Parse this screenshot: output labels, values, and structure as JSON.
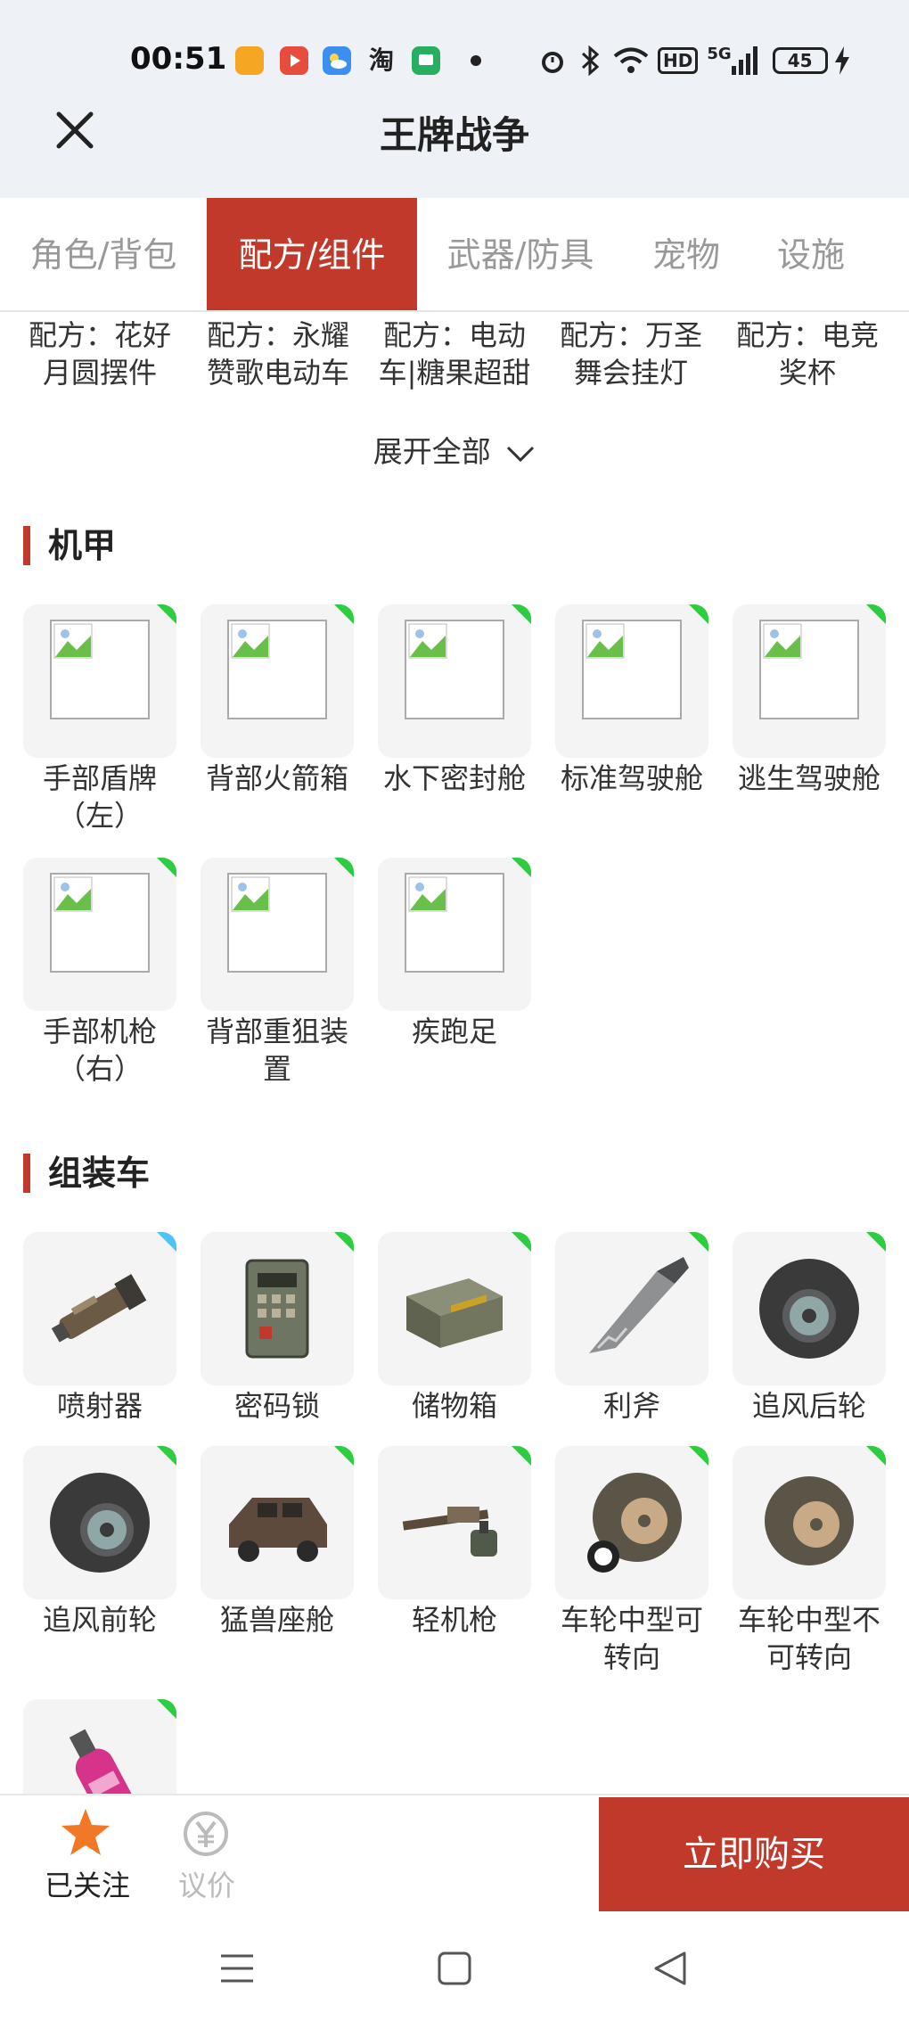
{
  "status_bar": {
    "time": "00:51",
    "battery": "45",
    "network": "5G",
    "hd": "HD",
    "app_taobao": "淘"
  },
  "header": {
    "title": "王牌战争"
  },
  "tabs": [
    {
      "label": "角色/背包",
      "active": false
    },
    {
      "label": "配方/组件",
      "active": true
    },
    {
      "label": "武器/防具",
      "active": false
    },
    {
      "label": "宠物",
      "active": false
    },
    {
      "label": "设施",
      "active": false
    }
  ],
  "recipes": [
    "配方：花好月圆摆件",
    "配方：永耀赞歌电动车",
    "配方：电动车|糖果超甜",
    "配方：万圣舞会挂灯",
    "配方：电竞奖杯"
  ],
  "expand_label": "展开全部",
  "sections": {
    "mecha": {
      "title": "机甲",
      "items": [
        {
          "label": "手部盾牌（左）",
          "icon": "broken-image-icon"
        },
        {
          "label": "背部火箭箱",
          "icon": "broken-image-icon"
        },
        {
          "label": "水下密封舱",
          "icon": "broken-image-icon"
        },
        {
          "label": "标准驾驶舱",
          "icon": "broken-image-icon"
        },
        {
          "label": "逃生驾驶舱",
          "icon": "broken-image-icon"
        },
        {
          "label": "手部机枪（右）",
          "icon": "broken-image-icon"
        },
        {
          "label": "背部重狙装置",
          "icon": "broken-image-icon"
        },
        {
          "label": "疾跑足",
          "icon": "broken-image-icon"
        }
      ]
    },
    "vehicle": {
      "title": "组装车",
      "items": [
        {
          "label": "喷射器",
          "icon": "jet-thruster-icon"
        },
        {
          "label": "密码锁",
          "icon": "code-lock-icon"
        },
        {
          "label": "储物箱",
          "icon": "storage-box-icon"
        },
        {
          "label": "利斧",
          "icon": "blade-icon"
        },
        {
          "label": "追风后轮",
          "icon": "rear-wheel-icon"
        },
        {
          "label": "追风前轮",
          "icon": "front-wheel-icon"
        },
        {
          "label": "猛兽座舱",
          "icon": "cockpit-icon"
        },
        {
          "label": "轻机枪",
          "icon": "light-machine-gun-icon"
        },
        {
          "label": "车轮中型可转向",
          "icon": "medium-wheel-steerable-icon"
        },
        {
          "label": "车轮中型不可转向",
          "icon": "medium-wheel-fixed-icon"
        },
        {
          "label": "",
          "icon": "nitro-bottle-icon"
        }
      ]
    }
  },
  "bottom_bar": {
    "follow_label": "已关注",
    "bargain_label": "议价",
    "buy_label": "立即购买"
  },
  "colors": {
    "accent": "#c0392b",
    "new_badge": "#2ecc40",
    "badge_blue": "#4fc3f7"
  }
}
